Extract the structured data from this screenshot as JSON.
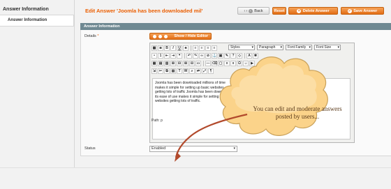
{
  "sidebar": {
    "title": "Answer Information",
    "tab_label": "Answer Information"
  },
  "header": {
    "title": "Edit Answer 'Joomla has been downloaded mil'",
    "buttons": {
      "back": "Back",
      "reset": "Reset",
      "delete": "Delete Answer",
      "save": "Save Answer"
    }
  },
  "form": {
    "section_title": "Answer Information",
    "details_label": "Details",
    "required_mark": "*",
    "toggle_editor": "Show / Hide Editor",
    "status_label": "Status",
    "status_value": "Enabled"
  },
  "editor": {
    "selects": {
      "styles": "Styles",
      "paragraph": "Paragraph",
      "font_family": "Font Family",
      "font_size": "Font Size"
    },
    "content_lines": [
      "Joomla has been downloaded millions of time",
      "makes it simple for setting up basic websites",
      "getting lots of traffic Joomla has been downl",
      "its ease of use makes it simple for setting u",
      "websites getting lots of traffic."
    ],
    "path": "Path: p"
  },
  "callout": {
    "text": "You can edit and moderate answers posted by users..."
  },
  "colors": {
    "accent": "#eb5e00",
    "section_header": "#6f8992",
    "cloud_fill": "#fbd38a",
    "arrow": "#b24a2c"
  }
}
